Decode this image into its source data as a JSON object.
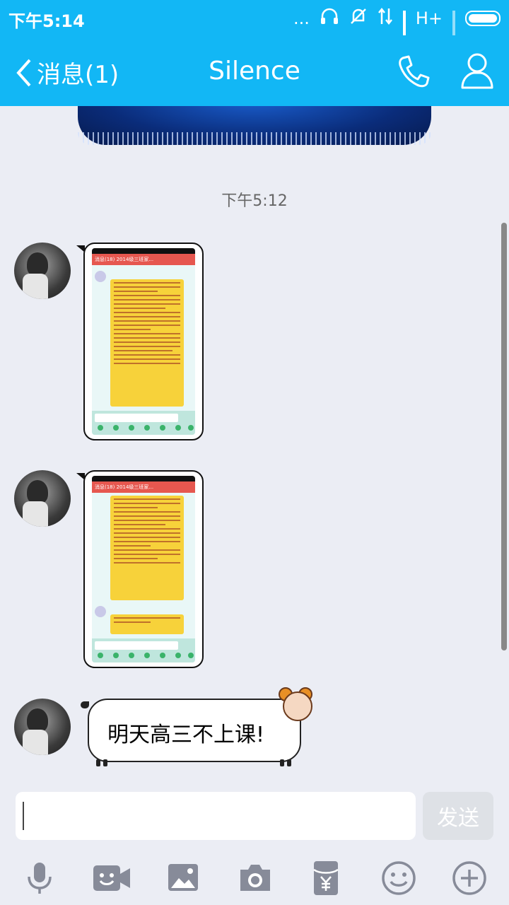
{
  "status_bar": {
    "time": "下午5:14",
    "dots": "...",
    "network": "H+"
  },
  "header": {
    "back_label": "消息(1)",
    "title": "Silence"
  },
  "chat": {
    "timestamp": "下午5:12",
    "messages": [
      {
        "type": "image",
        "sender": "contact",
        "shot_title": "消息(18)   2014级三班家..."
      },
      {
        "type": "image",
        "sender": "contact",
        "shot_title": "消息(18)   2014级三班家..."
      },
      {
        "type": "text",
        "sender": "contact",
        "text": "明天高三不上课!"
      }
    ]
  },
  "input": {
    "value": "",
    "send_label": "发送"
  },
  "toolbar": {
    "icons": [
      "microphone-icon",
      "video-call-icon",
      "image-icon",
      "camera-icon",
      "red-packet-icon",
      "emoji-icon",
      "plus-icon"
    ]
  },
  "colors": {
    "primary": "#12b7f5",
    "background": "#ebedf4",
    "send_disabled": "#dee1e6"
  }
}
